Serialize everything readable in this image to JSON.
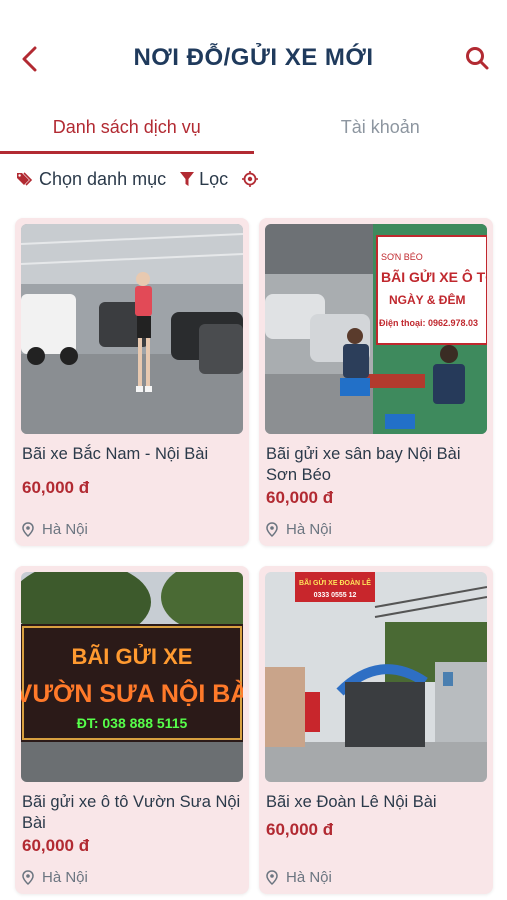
{
  "header": {
    "title": "NƠI ĐỖ/GỬI XE MỚI"
  },
  "tabs": [
    {
      "label": "Danh sách dịch vụ"
    },
    {
      "label": "Tài khoản"
    }
  ],
  "filters": {
    "category": "Chọn danh mục",
    "filter": "Lọc"
  },
  "cards": [
    {
      "name": "Bãi xe Bắc Nam - Nội Bài",
      "price": "60,000 đ",
      "location": "Hà Nội"
    },
    {
      "name": "Bãi gửi xe sân bay Nội Bài Sơn Béo",
      "price": "60,000 đ",
      "location": "Hà Nội",
      "sign_top": "SƠN BÉO",
      "sign_main": "BÃI GỬI XE Ô TÔ",
      "sign_sub": "NGÀY & ĐÊM",
      "sign_phone": "Điện thoại: 0962.978.03"
    },
    {
      "name": "Bãi gửi xe ô tô Vườn Sưa Nội Bài",
      "price": "60,000 đ",
      "location": "Hà Nội",
      "sign_main": "BÃI GỬI XE",
      "sign_sub": "VƯỜN SƯA NỘI BÀ",
      "sign_phone": "ĐT: 038 888 5115"
    },
    {
      "name": "Bãi xe Đoàn Lê Nội Bài",
      "price": "60,000 đ",
      "location": "Hà Nội",
      "sign_main": "BÃI GỬI XE ĐOÀN LÊ",
      "sign_phone": "0333 0555 12"
    }
  ]
}
